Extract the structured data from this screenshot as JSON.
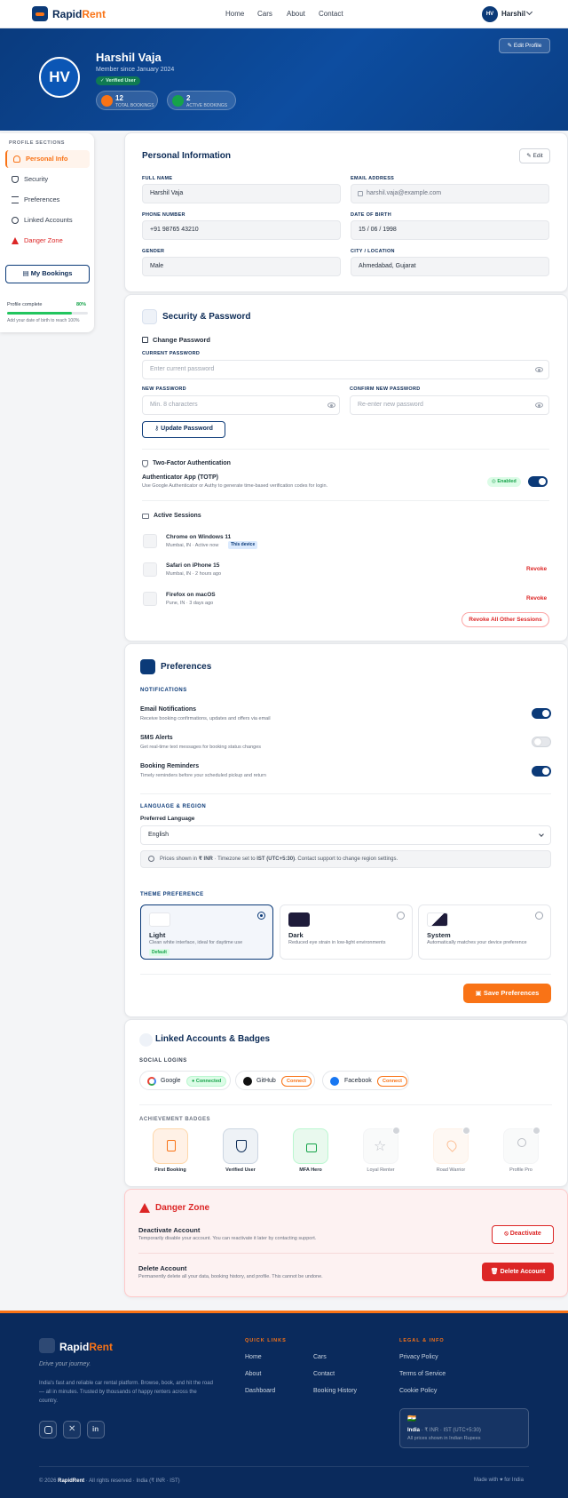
{
  "nav": {
    "brand_a": "Rapid",
    "brand_b": "Rent",
    "links": [
      "Home",
      "Cars",
      "About",
      "Contact"
    ],
    "user_initials": "HV",
    "user_name": "Harshil"
  },
  "hero": {
    "initials": "HV",
    "name": "Harshil Vaja",
    "since": "Member since January 2024",
    "verified": "✓ Verified User",
    "edit": "✎ Edit Profile",
    "stats": [
      {
        "n": "12",
        "l": "TOTAL BOOKINGS"
      },
      {
        "n": "2",
        "l": "ACTIVE BOOKINGS"
      }
    ]
  },
  "sidebar": {
    "heading": "PROFILE SECTIONS",
    "items": [
      "Personal Info",
      "Security",
      "Preferences",
      "Linked Accounts",
      "Danger Zone"
    ],
    "my_bookings": "My Bookings",
    "complete_label": "Profile complete",
    "complete_value": "80%",
    "complete_fraction": 0.8,
    "hint": "Add your date of birth to reach 100%"
  },
  "personal": {
    "title": "Personal Information",
    "edit": "✎ Edit",
    "fields": [
      {
        "label": "FULL NAME",
        "value": "Harshil Vaja"
      },
      {
        "label": "EMAIL ADDRESS",
        "value": "harshil.vaja@example.com"
      },
      {
        "label": "PHONE NUMBER",
        "value": "+91 98765 43210"
      },
      {
        "label": "DATE OF BIRTH",
        "value": "15 / 06 / 1998"
      },
      {
        "label": "GENDER",
        "value": "Male"
      },
      {
        "label": "CITY / LOCATION",
        "value": "Ahmedabad, Gujarat"
      }
    ]
  },
  "security": {
    "title": "Security & Password",
    "change_pw": "Change Password",
    "current_label": "CURRENT PASSWORD",
    "current_ph": "Enter current password",
    "new_label": "NEW PASSWORD",
    "new_ph": "Min. 8 characters",
    "confirm_label": "CONFIRM NEW PASSWORD",
    "confirm_ph": "Re-enter new password",
    "update_btn": "Update Password",
    "tfa_title": "Two-Factor Authentication",
    "tfa_app": "Authenticator App (TOTP)",
    "tfa_desc": "Use Google Authenticator or Authy to generate time-based verification codes for login.",
    "tfa_status": "◎ Enabled",
    "sessions_title": "Active Sessions",
    "sessions": [
      {
        "device": "Chrome on Windows 11",
        "meta": "Mumbai, IN · Active now",
        "badge": "This device"
      },
      {
        "device": "Safari on iPhone 15",
        "meta": "Mumbai, IN · 2 hours ago",
        "action": "Revoke"
      },
      {
        "device": "Firefox on macOS",
        "meta": "Pune, IN · 3 days ago",
        "action": "Revoke"
      }
    ],
    "revoke_all": "Revoke All Other Sessions"
  },
  "prefs": {
    "title": "Preferences",
    "notif_label": "NOTIFICATIONS",
    "notifs": [
      {
        "t": "Email Notifications",
        "d": "Receive booking confirmations, updates and offers via email"
      },
      {
        "t": "SMS Alerts",
        "d": "Get real-time text messages for booking status changes"
      },
      {
        "t": "Booking Reminders",
        "d": "Timely reminders before your scheduled pickup and return"
      }
    ],
    "lang_label": "LANGUAGE & REGION",
    "pref_lang": "Preferred Language",
    "lang_value": "English",
    "info_a": "Prices shown in ",
    "info_inr": "₹ INR",
    "info_b": " · Timezone set to ",
    "info_tz": "IST (UTC+5:30)",
    "info_c": ". Contact support to change region settings.",
    "theme_label": "THEME PREFERENCE",
    "themes": [
      {
        "t": "Light",
        "d": "Clean white interface, ideal for daytime use",
        "badge": "Default"
      },
      {
        "t": "Dark",
        "d": "Reduced eye strain in low-light environments"
      },
      {
        "t": "System",
        "d": "Automatically matches your device preference"
      }
    ],
    "save": "Save Preferences"
  },
  "linked": {
    "title": "Linked Accounts & Badges",
    "social_label": "SOCIAL LOGINS",
    "socials": [
      {
        "n": "Google",
        "s": "● Connected"
      },
      {
        "n": "GitHub",
        "s": "Connect"
      },
      {
        "n": "Facebook",
        "s": "Connect"
      }
    ],
    "badges_label": "ACHIEVEMENT BADGES",
    "badges": [
      "First Booking",
      "Verified User",
      "MFA Hero",
      "Loyal Renter",
      "Road Warrior",
      "Profile Pro"
    ]
  },
  "danger": {
    "title": "Danger Zone",
    "deact_t": "Deactivate Account",
    "deact_d": "Temporarily disable your account. You can reactivate it later by contacting support.",
    "deact_btn": "Deactivate",
    "del_t": "Delete Account",
    "del_d": "Permanently delete all your data, booking history, and profile. This cannot be undone.",
    "del_btn": "Delete Account"
  },
  "footer": {
    "brand_a": "Rapid",
    "brand_b": "Rent",
    "tagline": "Drive your journey.",
    "desc": "India's fast and reliable car rental platform. Browse, book, and hit the road — all in minutes. Trusted by thousands of happy renters across the country.",
    "quick_head": "QUICK LINKS",
    "quick": [
      "Home",
      "Cars",
      "About",
      "Contact",
      "Dashboard",
      "Booking History"
    ],
    "legal_head": "LEGAL & INFO",
    "legal": [
      "Privacy Policy",
      "Terms of Service",
      "Cookie Policy"
    ],
    "region_flag": "🇮🇳",
    "region_name": "India",
    "region_meta": "· ₹ INR · IST (UTC+5:30)",
    "region_note": "All prices shown in Indian Rupees",
    "copy_a": "© 2026 ",
    "copy_brand": "RapidRent",
    "copy_b": " · All rights reserved · India (₹ INR · IST)",
    "made": "Made with ♥ for India"
  },
  "colors": {
    "primary": "#0b3a78",
    "accent": "#f97316",
    "danger": "#dc2626",
    "success": "#16a34a"
  }
}
